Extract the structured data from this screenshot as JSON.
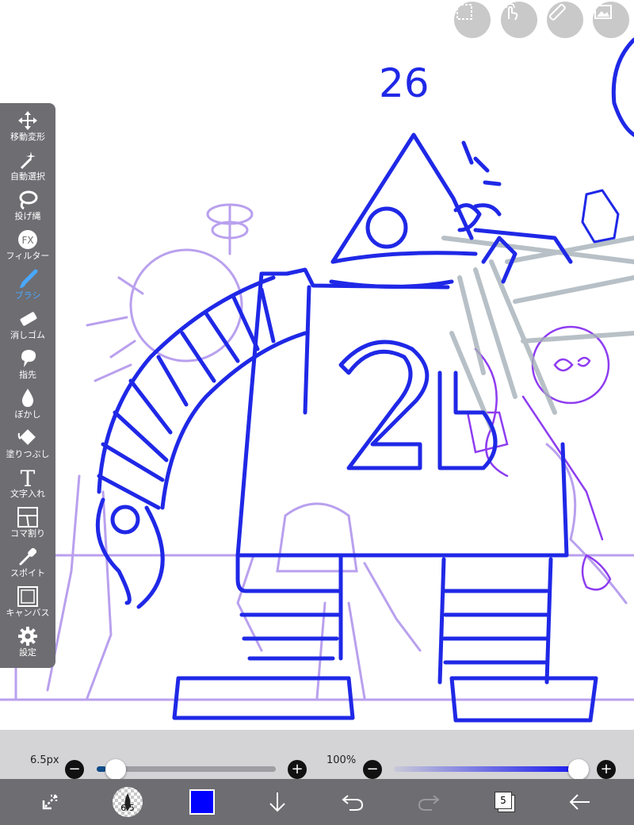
{
  "canvas": {
    "drawing_text": "26",
    "shirt_number": "26"
  },
  "top_buttons": [
    {
      "name": "selection-icon"
    },
    {
      "name": "touch-gesture-icon"
    },
    {
      "name": "ruler-icon"
    },
    {
      "name": "layer-image-icon"
    }
  ],
  "toolbar": {
    "items": [
      {
        "label": "移動変形",
        "icon": "move-arrows-icon"
      },
      {
        "label": "自動選択",
        "icon": "magic-wand-icon"
      },
      {
        "label": "投げ縄",
        "icon": "lasso-icon"
      },
      {
        "label": "フィルター",
        "icon": "fx-icon",
        "icon_text": "FX"
      },
      {
        "label": "ブラシ",
        "icon": "brush-icon",
        "active": true
      },
      {
        "label": "消しゴム",
        "icon": "eraser-icon"
      },
      {
        "label": "指先",
        "icon": "finger-smudge-icon"
      },
      {
        "label": "ぼかし",
        "icon": "blur-drop-icon"
      },
      {
        "label": "塗りつぶし",
        "icon": "fill-bucket-icon"
      },
      {
        "label": "文字入れ",
        "icon": "text-icon",
        "icon_text": "T"
      },
      {
        "label": "コマ割り",
        "icon": "frame-divider-icon"
      },
      {
        "label": "スポイト",
        "icon": "eyedropper-icon"
      },
      {
        "label": "キャンバス",
        "icon": "canvas-icon"
      },
      {
        "label": "設定",
        "icon": "gear-icon"
      }
    ],
    "active_color": "#4aa8ff"
  },
  "brush_size": {
    "value": "6.5px",
    "level": 0.05
  },
  "opacity": {
    "value": "100%",
    "level": 1.0
  },
  "bottom_bar": {
    "brush_badge": "6.5",
    "current_color": "#0000ff",
    "layer_count": "5"
  }
}
